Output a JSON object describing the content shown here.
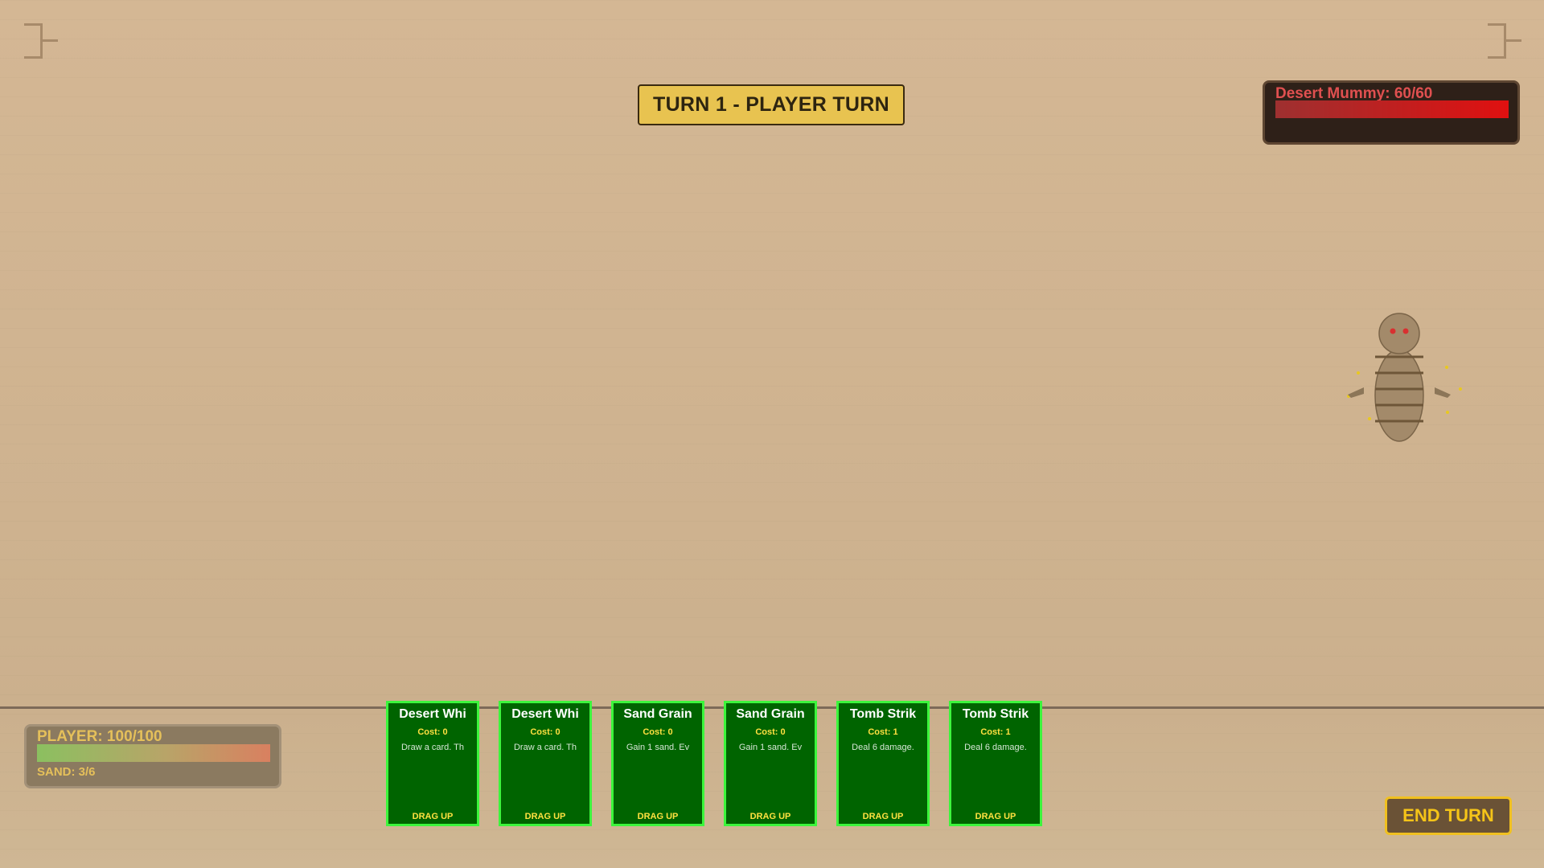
{
  "turn": {
    "banner": "TURN 1 - PLAYER TURN"
  },
  "enemy": {
    "label": "Desert Mummy: 60/60",
    "hp": 60,
    "hp_max": 60,
    "bar_color": "#e01010"
  },
  "player": {
    "label": "PLAYER: 100/100",
    "hp": 100,
    "hp_max": 100,
    "sand_label": "SAND: 3/6"
  },
  "hand": [
    {
      "title": "Desert Whi",
      "cost": "Cost: 0",
      "desc": "Draw a card. Th",
      "drag": "DRAG UP"
    },
    {
      "title": "Desert Whi",
      "cost": "Cost: 0",
      "desc": "Draw a card. Th",
      "drag": "DRAG UP"
    },
    {
      "title": "Sand Grain",
      "cost": "Cost: 0",
      "desc": "Gain 1 sand. Ev",
      "drag": "DRAG UP"
    },
    {
      "title": "Sand Grain",
      "cost": "Cost: 0",
      "desc": "Gain 1 sand. Ev",
      "drag": "DRAG UP"
    },
    {
      "title": "Tomb Strik",
      "cost": "Cost: 1",
      "desc": "Deal 6 damage.",
      "drag": "DRAG UP"
    },
    {
      "title": "Tomb Strik",
      "cost": "Cost: 1",
      "desc": "Deal 6 damage.",
      "drag": "DRAG UP"
    }
  ],
  "end_turn": {
    "label": "END TURN"
  },
  "colors": {
    "card_bg": "#006400",
    "card_border": "#3cf53c",
    "accent_gold": "#f5c418"
  }
}
